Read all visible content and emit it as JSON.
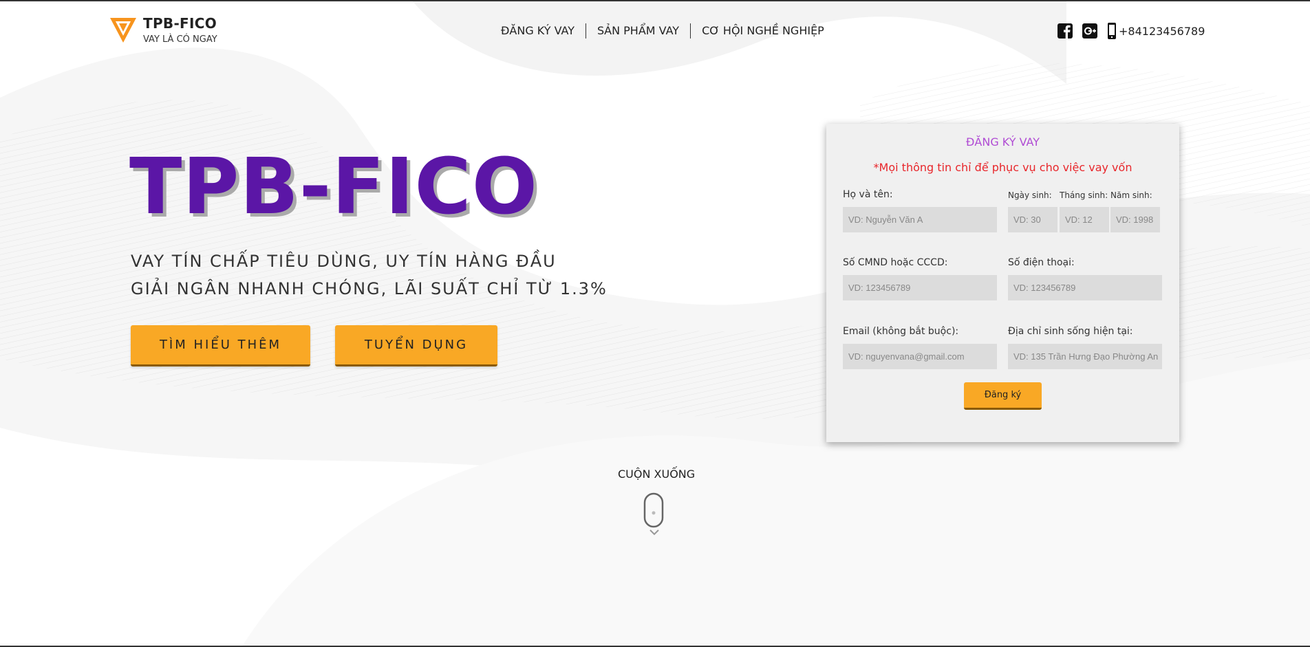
{
  "brand": {
    "name": "TPB-FICO",
    "tagline": "VAY LÀ CÓ NGAY",
    "accent_orange": "#f9a825",
    "accent_purple": "#5b16a6"
  },
  "nav": {
    "items": [
      {
        "label": "ĐĂNG KÝ VAY"
      },
      {
        "label": "SẢN PHẨM VAY"
      },
      {
        "label": "CƠ HỘI NGHỀ NGHIỆP"
      }
    ]
  },
  "social": {
    "icons": [
      "facebook-icon",
      "google-plus-icon",
      "phone-icon"
    ],
    "phone": "+84123456789"
  },
  "hero": {
    "title": "TPB-FICO",
    "line1": "VAY TÍN CHẤP TIÊU DÙNG, UY TÍN HÀNG ĐẦU",
    "line2": "GIẢI NGÂN NHANH CHÓNG, LÃI SUẤT CHỈ TỪ 1.3%",
    "btn_learn": "TÌM HIỂU THÊM",
    "btn_recruit": "TUYỂN DỤNG",
    "scroll_label": "CUỘN XUỐNG"
  },
  "form": {
    "title": "ĐĂNG KÝ VAY",
    "note": "*Mọi thông tin chỉ để phục vụ cho việc vay vốn",
    "name_label": "Họ và tên:",
    "name_placeholder": "VD: Nguyễn Văn A",
    "day_label": "Ngày sinh:",
    "day_placeholder": "VD: 30",
    "month_label": "Tháng sinh:",
    "month_placeholder": "VD: 12",
    "year_label": "Năm sinh:",
    "year_placeholder": "VD: 1998",
    "id_label": "Số CMND hoặc CCCD:",
    "id_placeholder": "VD: 123456789",
    "phone_label": "Số điện thoại:",
    "phone_placeholder": "VD: 123456789",
    "email_label": "Email (không bắt buộc):",
    "email_placeholder": "VD: nguyenvana@gmail.com",
    "address_label": "Địa chỉ sinh sống hiện tại:",
    "address_placeholder": "VD: 135 Trần Hưng Đạo Phường An",
    "submit": "Đăng ký"
  }
}
